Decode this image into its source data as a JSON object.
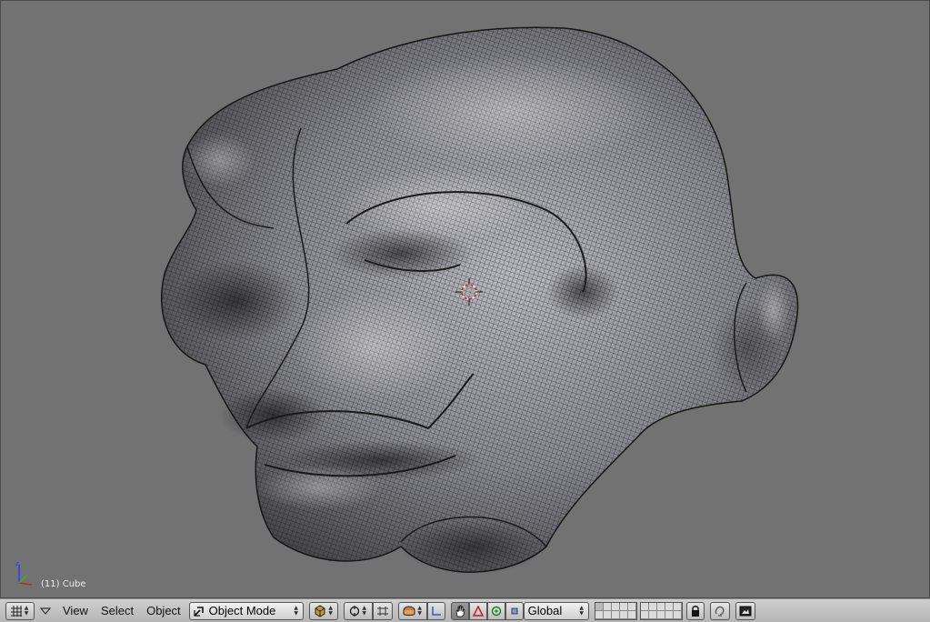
{
  "viewport": {
    "object_info": "(11) Cube",
    "background": "#727272"
  },
  "header": {
    "menus": {
      "view": "View",
      "select": "Select",
      "object": "Object"
    },
    "mode_select": {
      "value": "Object Mode"
    },
    "orientation_select": {
      "value": "Global"
    }
  },
  "icons": {
    "editor_type": "grid-icon",
    "menu_collapse": "triangle-down-icon",
    "mode": "object-mode-icon",
    "draw_type": "shading-icon",
    "pivot": "pivot-icon",
    "proportional": "proportional-edit-icon",
    "manipulator": "manipulator-icon",
    "lock": "lock-icon",
    "render": "render-icon"
  }
}
